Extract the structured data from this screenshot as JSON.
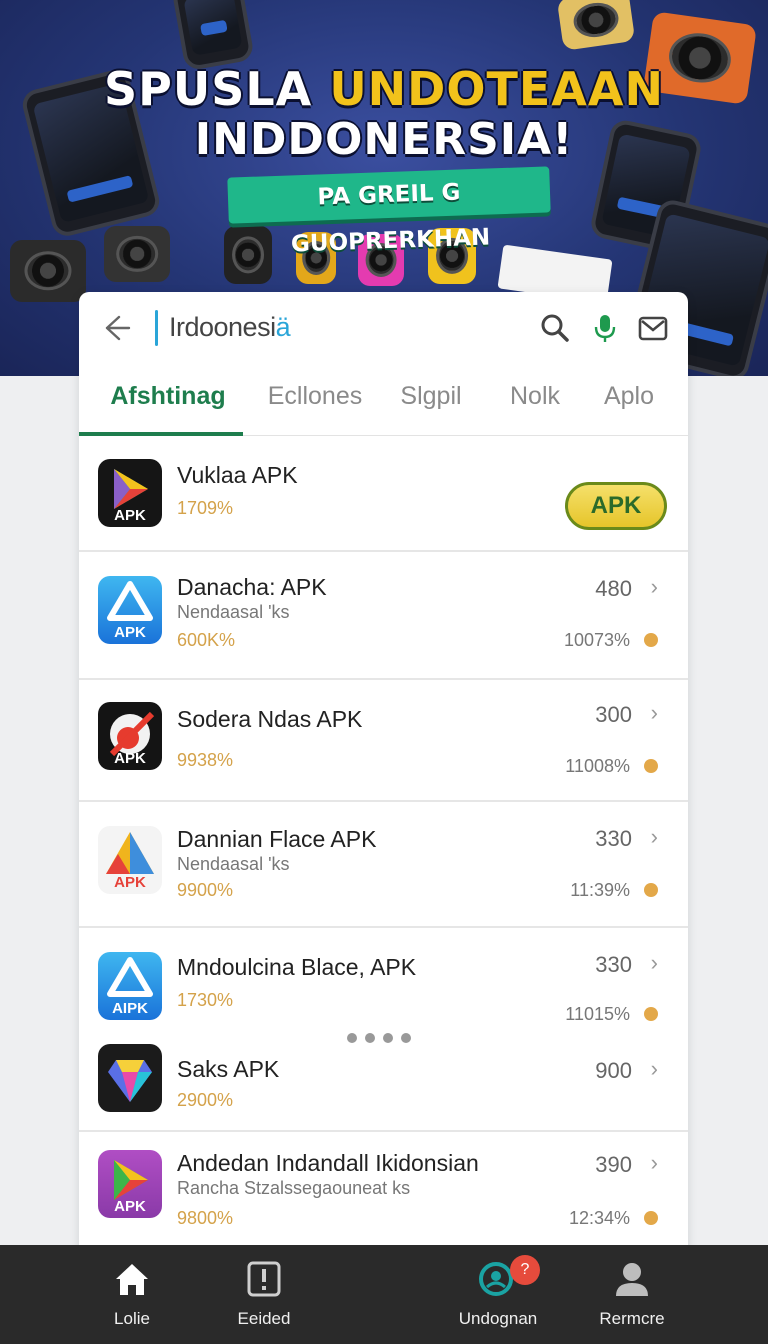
{
  "hero": {
    "title_white": "SPUSLA",
    "title_yellow": "UNDOTEAAN",
    "title_line2": "INDDONERSIA!",
    "tag": "PA GREIL G GUOPRERKHAN"
  },
  "search": {
    "query_main": "Irdoonesi",
    "query_accent": "ä"
  },
  "tabs": [
    "Afshtinag",
    "Ecllones",
    "Slgpil",
    "Nolk",
    "Aplo"
  ],
  "apps": [
    {
      "name": "Vuklaa APK",
      "subtitle": "",
      "percent": "1709%",
      "count": "",
      "right_percent": "",
      "icon": "play-store-icon",
      "icon_label": "APK",
      "action_label": "APK"
    },
    {
      "name": "Danacha: APK",
      "subtitle": "Nendaasal 'ks",
      "percent": "600K%",
      "count": "480",
      "right_percent": "10073%",
      "icon": "triangle-apk-icon",
      "icon_label": "APK"
    },
    {
      "name": "Sodera Ndas APK",
      "subtitle": "",
      "percent": "9938%",
      "count": "300",
      "right_percent": "11008%",
      "icon": "red-circle-icon",
      "icon_label": "APK"
    },
    {
      "name": "Dannian Flace  APK",
      "subtitle": "Nendaasal 'ks",
      "percent": "9900%",
      "count": "330",
      "right_percent": "11:39%",
      "icon": "colorful-triangle-icon",
      "icon_label": "APK"
    },
    {
      "name": "Mndoulcina Blace, APK",
      "subtitle": "",
      "percent": "1730%",
      "count": "330",
      "right_percent": "11015%",
      "icon": "triangle-apk-icon",
      "icon_label": "AIPK"
    },
    {
      "name": "Saks APK",
      "subtitle": "",
      "percent": "2900%",
      "count": "900",
      "right_percent": "",
      "icon": "gem-icon",
      "icon_label": ""
    },
    {
      "name": "Andedan Indandall Ikidonsian",
      "subtitle": "Rancha Stzalssegaouneat ks",
      "percent": "9800%",
      "count": "390",
      "right_percent": "12:34%",
      "icon": "play-store-icon",
      "icon_label": "APK"
    }
  ],
  "nav": [
    {
      "label": "Lolie",
      "icon": "home-icon"
    },
    {
      "label": "Eeided",
      "icon": "alert-icon"
    },
    {
      "label": "Undognan",
      "icon": "search-icon",
      "badge": "?"
    },
    {
      "label": "Rermcre",
      "icon": "profile-icon"
    }
  ],
  "colors": {
    "accent": "#1e7d4d",
    "search_caret": "#2aa5d8",
    "percent": "#d4a24a",
    "nav_bg": "#2a2a2a"
  }
}
